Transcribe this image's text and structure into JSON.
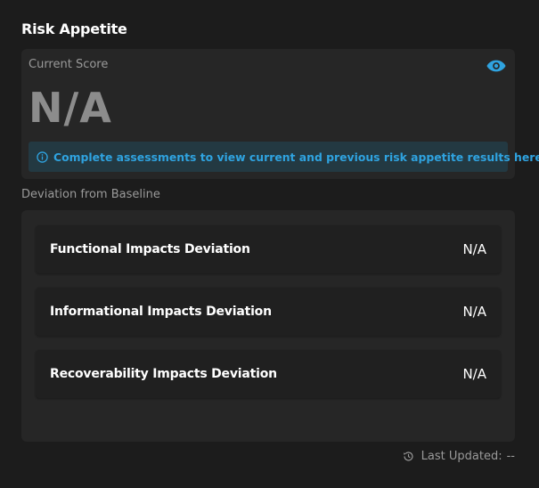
{
  "header": {
    "title": "Risk Appetite"
  },
  "score": {
    "label": "Current Score",
    "value": "N/A",
    "visibility_icon": "eye-icon"
  },
  "info": {
    "icon": "info-circle-icon",
    "text": "Complete assessments to view current and previous risk appetite results here."
  },
  "deviation": {
    "label": "Deviation from Baseline",
    "rows": [
      {
        "name": "Functional Impacts Deviation",
        "value": "N/A"
      },
      {
        "name": "Informational Impacts Deviation",
        "value": "N/A"
      },
      {
        "name": "Recoverability Impacts Deviation",
        "value": "N/A"
      }
    ]
  },
  "footer": {
    "icon": "history-icon",
    "last_updated_label": "Last Updated:",
    "last_updated_value": "--"
  },
  "colors": {
    "background": "#1c1c1c",
    "card": "#262626",
    "accent": "#2fa3e0",
    "banner": "#233942"
  }
}
